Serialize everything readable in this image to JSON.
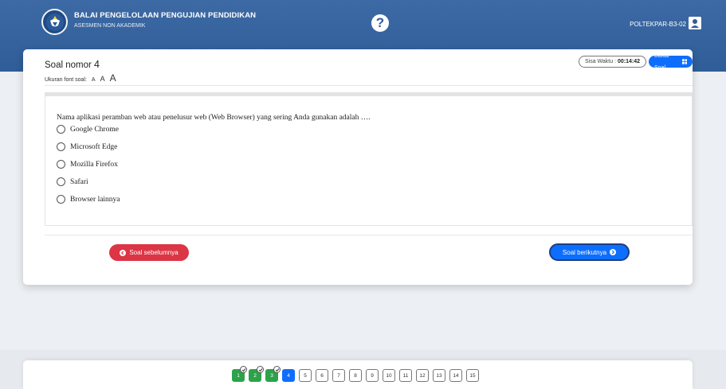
{
  "header": {
    "org_title": "BALAI PENGELOLAAN PENGUJIAN PENDIDIKAN",
    "org_subtitle": "ASESMEN NON AKADEMIK",
    "help_symbol": "?",
    "username": "POLTEKPAR-B3-02",
    "logo_icon": "tut-wuri-handayani-logo",
    "user_icon": "user-icon",
    "colors": {
      "header_bg": "#2f5d97"
    }
  },
  "question": {
    "title_prefix": "Soal nomor",
    "number": "4",
    "font_size_label": "Ukuran font soal:",
    "font_sizes": [
      "A",
      "A",
      "A"
    ],
    "timer_label": "Sisa Waktu :",
    "timer_value": "00:14:42",
    "list_button": "Daftar Soal",
    "text": "Nama aplikasi peramban web atau penelusur web (Web Browser) yang sering Anda gunakan adalah ….",
    "options": [
      "Google Chrome",
      "Microsoft Edge",
      "Mozilla Firefox",
      "Safari",
      "Browser lainnya"
    ],
    "selected_option": null
  },
  "navigation": {
    "prev_label": "Soal sebelumnya",
    "next_label": "Soal berikutnya",
    "colors": {
      "prev": "#dc3545",
      "next": "#0d6efd",
      "answered": "#2ca24a",
      "current": "#0d6efd"
    },
    "items": [
      {
        "label": "1",
        "status": "answered"
      },
      {
        "label": "2",
        "status": "answered"
      },
      {
        "label": "3",
        "status": "answered"
      },
      {
        "label": "4",
        "status": "current"
      },
      {
        "label": "5",
        "status": "unanswered"
      },
      {
        "label": "6",
        "status": "unanswered"
      },
      {
        "label": "7",
        "status": "unanswered"
      },
      {
        "label": "8",
        "status": "unanswered"
      },
      {
        "label": "9",
        "status": "unanswered"
      },
      {
        "label": "10",
        "status": "unanswered"
      },
      {
        "label": "11",
        "status": "unanswered"
      },
      {
        "label": "12",
        "status": "unanswered"
      },
      {
        "label": "13",
        "status": "unanswered"
      },
      {
        "label": "14",
        "status": "unanswered"
      },
      {
        "label": "15",
        "status": "unanswered"
      }
    ]
  }
}
